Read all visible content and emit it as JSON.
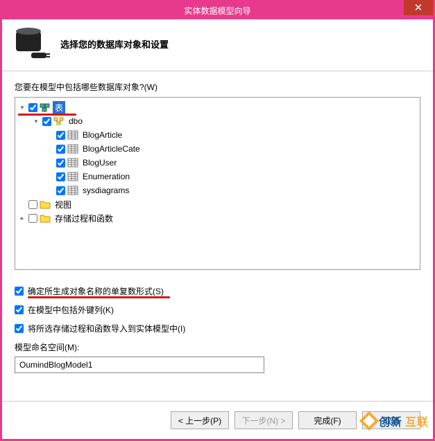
{
  "titlebar": {
    "title": "实体数据模型向导",
    "close": "✕"
  },
  "header": {
    "title": "选择您的数据库对象和设置"
  },
  "prompt": "您要在模型中包括哪些数据库对象?(W)",
  "tree": {
    "tables_label": "表",
    "schema_label": "dbo",
    "items": [
      "BlogArticle",
      "BlogArticleCate",
      "BlogUser",
      "Enumeration",
      "sysdiagrams"
    ],
    "views_label": "视图",
    "procs_label": "存储过程和函数"
  },
  "options": {
    "pluralize": "确定所生成对象名称的单复数形式(S)",
    "include_fk": "在模型中包括外键列(K)",
    "import_procs": "将所选存储过程和函数导入到实体模型中(I)"
  },
  "namespace": {
    "label": "模型命名空间(M):",
    "value": "OumindBlogModel1"
  },
  "buttons": {
    "prev": "< 上一步(P)",
    "next": "下一步(N) >",
    "finish": "完成(F)",
    "cancel": "取消"
  },
  "watermark": {
    "t1": "创新",
    "t2": "互联"
  }
}
